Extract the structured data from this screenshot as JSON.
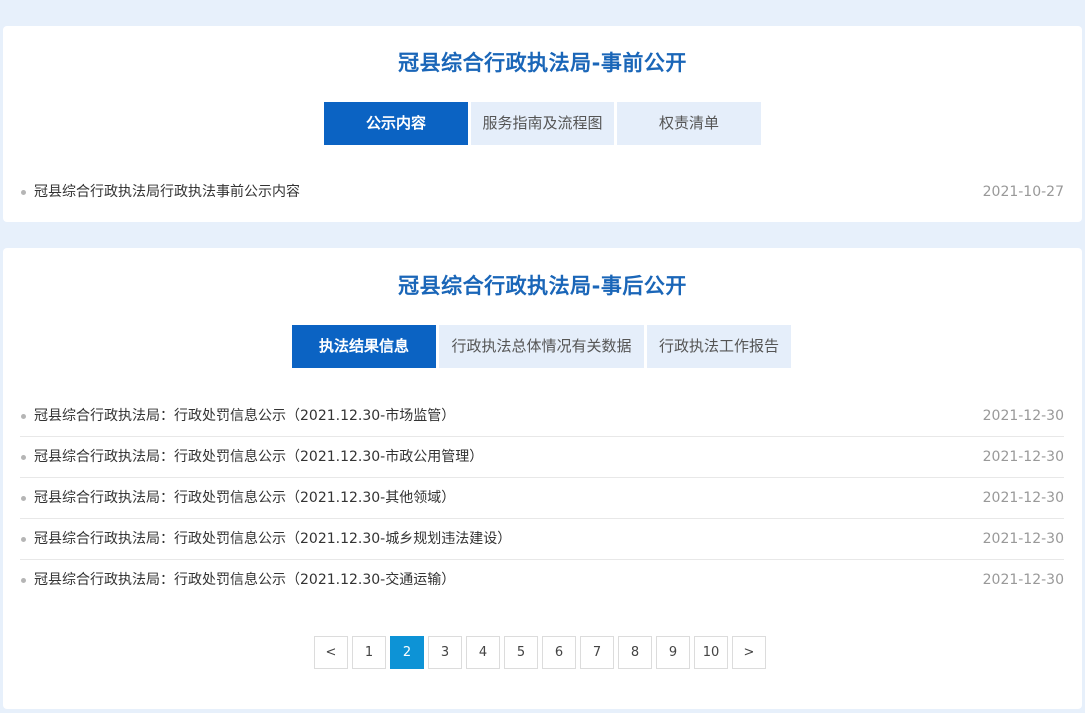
{
  "before": {
    "title": "冠县综合行政执法局-事前公开",
    "tabs": [
      {
        "label": "公示内容",
        "active": true
      },
      {
        "label": "服务指南及流程图",
        "active": false
      },
      {
        "label": "权责清单",
        "active": false
      }
    ],
    "items": [
      {
        "title": "冠县综合行政执法局行政执法事前公示内容",
        "date": "2021-10-27"
      }
    ]
  },
  "after": {
    "title": "冠县综合行政执法局-事后公开",
    "tabs": [
      {
        "label": "执法结果信息",
        "active": true
      },
      {
        "label": "行政执法总体情况有关数据",
        "active": false
      },
      {
        "label": "行政执法工作报告",
        "active": false
      }
    ],
    "items": [
      {
        "title": "冠县综合行政执法局：行政处罚信息公示（2021.12.30-市场监管）",
        "date": "2021-12-30"
      },
      {
        "title": "冠县综合行政执法局：行政处罚信息公示（2021.12.30-市政公用管理）",
        "date": "2021-12-30"
      },
      {
        "title": "冠县综合行政执法局：行政处罚信息公示（2021.12.30-其他领域）",
        "date": "2021-12-30"
      },
      {
        "title": "冠县综合行政执法局：行政处罚信息公示（2021.12.30-城乡规划违法建设）",
        "date": "2021-12-30"
      },
      {
        "title": "冠县综合行政执法局：行政处罚信息公示（2021.12.30-交通运输）",
        "date": "2021-12-30"
      }
    ]
  },
  "pagination": {
    "prev": "<",
    "next": ">",
    "pages": [
      "1",
      "2",
      "3",
      "4",
      "5",
      "6",
      "7",
      "8",
      "9",
      "10"
    ],
    "current": "2"
  },
  "colors": {
    "accent": "#0b63c3",
    "title": "#1a66b8",
    "page_active": "#0d93d6",
    "background": "#e7f0fb"
  }
}
